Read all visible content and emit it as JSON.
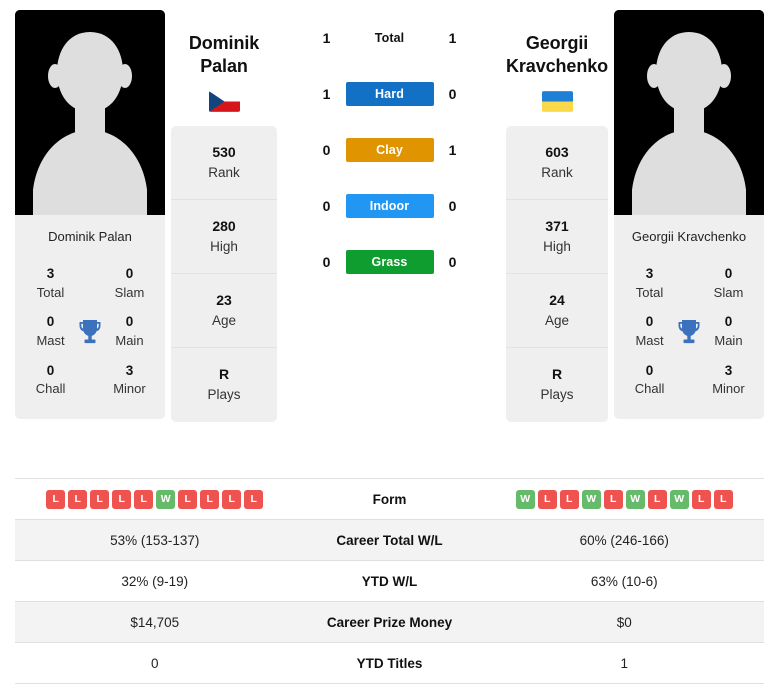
{
  "players": {
    "left": {
      "first_name": "Dominik",
      "last_name": "Palan",
      "full_name": "Dominik Palan",
      "country": "Czech Republic",
      "flag_icon": "flag-czech-republic",
      "avatar_icon": "person-placeholder-avatar",
      "rank": "530",
      "rank_label": "Rank",
      "high": "280",
      "high_label": "High",
      "age": "23",
      "age_label": "Age",
      "plays": "R",
      "plays_label": "Plays",
      "titles": {
        "total": "3",
        "total_label": "Total",
        "slam": "0",
        "slam_label": "Slam",
        "mast": "0",
        "mast_label": "Mast",
        "main": "0",
        "main_label": "Main",
        "chall": "0",
        "chall_label": "Chall",
        "minor": "3",
        "minor_label": "Minor"
      },
      "form": [
        "L",
        "L",
        "L",
        "L",
        "L",
        "W",
        "L",
        "L",
        "L",
        "L"
      ],
      "career_total_wl": "53% (153-137)",
      "ytd_wl": "32% (9-19)",
      "career_prize_money": "$14,705",
      "ytd_titles": "0"
    },
    "right": {
      "first_name": "Georgii",
      "last_name": "Kravchenko",
      "full_name": "Georgii Kravchenko",
      "country": "Ukraine",
      "flag_icon": "flag-ukraine",
      "avatar_icon": "person-placeholder-avatar",
      "rank": "603",
      "rank_label": "Rank",
      "high": "371",
      "high_label": "High",
      "age": "24",
      "age_label": "Age",
      "plays": "R",
      "plays_label": "Plays",
      "titles": {
        "total": "3",
        "total_label": "Total",
        "slam": "0",
        "slam_label": "Slam",
        "mast": "0",
        "mast_label": "Mast",
        "main": "0",
        "main_label": "Main",
        "chall": "0",
        "chall_label": "Chall",
        "minor": "3",
        "minor_label": "Minor"
      },
      "form": [
        "W",
        "L",
        "L",
        "W",
        "L",
        "W",
        "L",
        "W",
        "L",
        "L"
      ],
      "career_total_wl": "60% (246-166)",
      "ytd_wl": "63% (10-6)",
      "career_prize_money": "$0",
      "ytd_titles": "1"
    }
  },
  "head_to_head": {
    "trophy_icon": "trophy-icon",
    "trophy_color": "#3c72bd",
    "rows": [
      {
        "label": "Total",
        "left": "1",
        "right": "1",
        "color": "transparent",
        "text_color": "#111111",
        "is_badge": false
      },
      {
        "label": "Hard",
        "left": "1",
        "right": "0",
        "color": "#1271c4",
        "text_color": "#ffffff",
        "is_badge": true
      },
      {
        "label": "Clay",
        "left": "0",
        "right": "1",
        "color": "#e09400",
        "text_color": "#ffffff",
        "is_badge": true
      },
      {
        "label": "Indoor",
        "left": "0",
        "right": "0",
        "color": "#2196f3",
        "text_color": "#ffffff",
        "is_badge": true
      },
      {
        "label": "Grass",
        "left": "0",
        "right": "0",
        "color": "#0f9d2f",
        "text_color": "#ffffff",
        "is_badge": true
      }
    ]
  },
  "stats_table": {
    "rows": [
      {
        "label": "Form",
        "type": "form",
        "left": "",
        "right": ""
      },
      {
        "label": "Career Total W/L",
        "type": "text",
        "left": "53% (153-137)",
        "right": "60% (246-166)"
      },
      {
        "label": "YTD W/L",
        "type": "text",
        "left": "32% (9-19)",
        "right": "63% (10-6)"
      },
      {
        "label": "Career Prize Money",
        "type": "text",
        "left": "$14,705",
        "right": "$0"
      },
      {
        "label": "YTD Titles",
        "type": "text",
        "left": "0",
        "right": "1"
      }
    ]
  },
  "colors": {
    "win": "#66bb6a",
    "loss": "#ef5350",
    "panel": "#efefef",
    "row_shade": "#f3f3f3"
  }
}
